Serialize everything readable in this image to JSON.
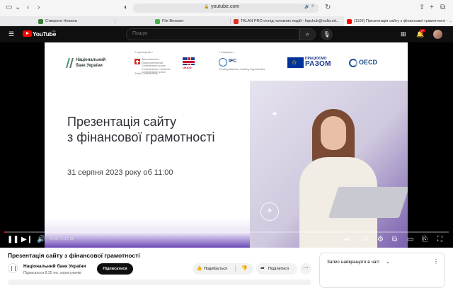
{
  "browser": {
    "url": "youtube.com",
    "tabs": [
      {
        "label": "Створити Новина",
        "color": "#3b7d3b"
      },
      {
        "label": "File Browser",
        "color": "#4caf50"
      },
      {
        "label": "TALAN PRO огляд головних подій - fspchuk@nulla.ed...",
        "color": "#d93025"
      },
      {
        "label": "(1106) Презентація сайту з фінансової грамотності - ...",
        "color": "#ff0000"
      }
    ]
  },
  "header": {
    "logo_text": "YouTube",
    "region": "UA",
    "search_placeholder": "Пошук",
    "notification_count": "9+"
  },
  "slide": {
    "nbu_line1": "Національний",
    "nbu_line2": "банк України",
    "support_caption": "У партнерстві з",
    "cooperation_caption": "У співпраці з",
    "swiss_text": "Schweizerische Eidgenossenschaft Confédération suisse Confederazione Svizzera Confederaziun svizra",
    "swiss_bottom": "Swiss Confederation",
    "ukaid": "UKAID",
    "ifc_text": "IFC",
    "ifc_sub": "Creating Markets, Creating Opportunities",
    "razom_top": "ПРАЦЮЄМО",
    "razom_main": "РАЗОМ",
    "oecd_text": "OECD",
    "title_line1": "Презентація сайту",
    "title_line2": "з фінансової грамотності",
    "date": "31 серпня 2023 року об 11:00"
  },
  "player": {
    "time": "0:02 / 1:17:35",
    "progress": 0.0004
  },
  "video": {
    "title": "Презентація сайту з фінансової грамотності",
    "channel_name": "Національний банк України",
    "subscribers": "Підписалося 8,35 тис. користувачів",
    "subscribe_label": "Підписатися",
    "like_label": "Подобається",
    "share_label": "Поділитися"
  },
  "chat": {
    "title": "Запис найкращого в чаті"
  }
}
